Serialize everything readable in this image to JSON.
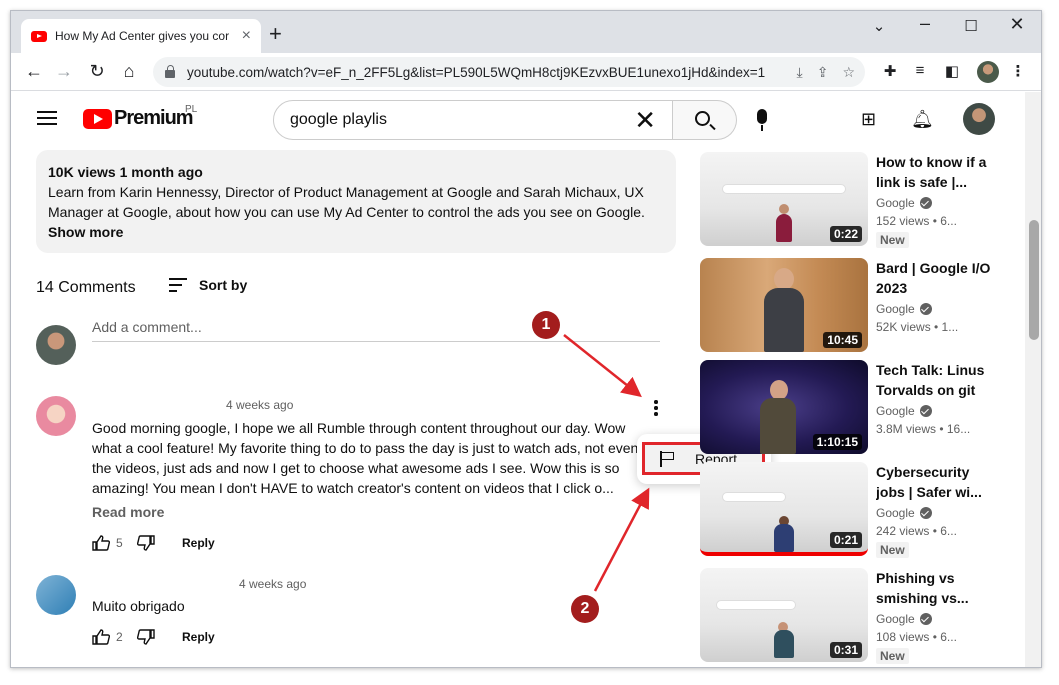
{
  "browser": {
    "tab_title": "How My Ad Center gives you cor",
    "url": "youtube.com/watch?v=eF_n_2FF5Lg&list=PL590L5WQmH8ctj9KEzvxBUE1unexo1jHd&index=1"
  },
  "masthead": {
    "logo_text": "Premium",
    "country_code": "PL",
    "search_value": "google playlis"
  },
  "description": {
    "meta": "10K views  1 month ago",
    "body": "Learn from Karin Hennessy, Director of Product Management at Google and Sarah Michaux, UX Manager at Google, about how you can use My Ad Center to control the ads you see on Google.",
    "show_more": "Show more"
  },
  "comments": {
    "count_label": "14 Comments",
    "sort_label": "Sort by",
    "add_placeholder": "Add a comment...",
    "items": [
      {
        "time": "4 weeks ago",
        "text": "Good morning google, I hope we all Rumble through content throughout our day.  Wow what a cool feature!  My favorite thing to do to pass the day is just to watch ads, not even the videos, just ads and now I get to choose what awesome ads I see. Wow this is so amazing!  You mean I don't HAVE to watch creator's content on videos that I click o...",
        "read_more": "Read more",
        "likes": "5",
        "reply": "Reply"
      },
      {
        "time": "4 weeks ago",
        "text": "Muito obrigado",
        "likes": "2",
        "reply": "Reply"
      }
    ],
    "menu_report": "Report"
  },
  "annotations": {
    "one": "1",
    "two": "2"
  },
  "sidebar": [
    {
      "title": "How to know if a link is safe |...",
      "channel": "Google",
      "meta": "152 views  •  6...",
      "badge": "New",
      "duration": "0:22"
    },
    {
      "title": "Bard | Google I/O 2023",
      "channel": "Google",
      "meta": "52K views  •  1...",
      "badge": "",
      "duration": "10:45"
    },
    {
      "title": "Tech Talk: Linus Torvalds on git",
      "channel": "Google",
      "meta": "3.8M views  •  16...",
      "badge": "",
      "duration": "1:10:15"
    },
    {
      "title": "Cybersecurity jobs | Safer wi...",
      "channel": "Google",
      "meta": "242 views  •  6...",
      "badge": "New",
      "duration": "0:21"
    },
    {
      "title": "Phishing vs smishing vs...",
      "channel": "Google",
      "meta": "108 views  •  6...",
      "badge": "New",
      "duration": "0:31"
    }
  ],
  "colors": {
    "accent_red": "#ff0000",
    "annotation_red": "#e0262b"
  }
}
